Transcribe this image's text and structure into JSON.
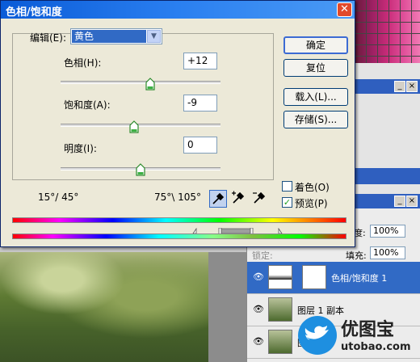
{
  "dialog": {
    "title": "色相/饱和度",
    "close_glyph": "✕",
    "edit_label": "编辑(E):",
    "edit_value": "黄色",
    "hue_label": "色相(H):",
    "hue_value": "+12",
    "saturation_label": "饱和度(A):",
    "saturation_value": "-9",
    "lightness_label": "明度(I):",
    "lightness_value": "0",
    "range_left": "15°/ 45°",
    "range_right": "75°\\ 105°",
    "buttons": {
      "ok": "确定",
      "reset": "复位",
      "load": "载入(L)...",
      "save": "存储(S)..."
    },
    "colorize_label": "着色(O)",
    "colorize_checked": false,
    "preview_label": "预览(P)",
    "preview_checked": true,
    "preview_check_glyph": "✓",
    "sliders": {
      "hue_level": 0.56,
      "saturation_level": 0.46,
      "lightness_level": 0.5
    }
  },
  "layers_panel": {
    "opacity_label": "度:",
    "opacity_value": "100%",
    "fill_label": "填充:",
    "fill_value": "100%",
    "lock_label": "锁定:",
    "layers": [
      {
        "name": "色相/饱和度 1",
        "selected": true
      },
      {
        "name": "图层 1 副本",
        "selected": false
      },
      {
        "name": "图层 1",
        "selected": false
      }
    ]
  },
  "watermark": {
    "brand_cn": "优图宝",
    "brand_url": "utobao.com"
  },
  "colors": {
    "title_blue": "#0a5bd7",
    "selection_blue": "#316ac5",
    "dialog_bg": "#ece9d8"
  }
}
